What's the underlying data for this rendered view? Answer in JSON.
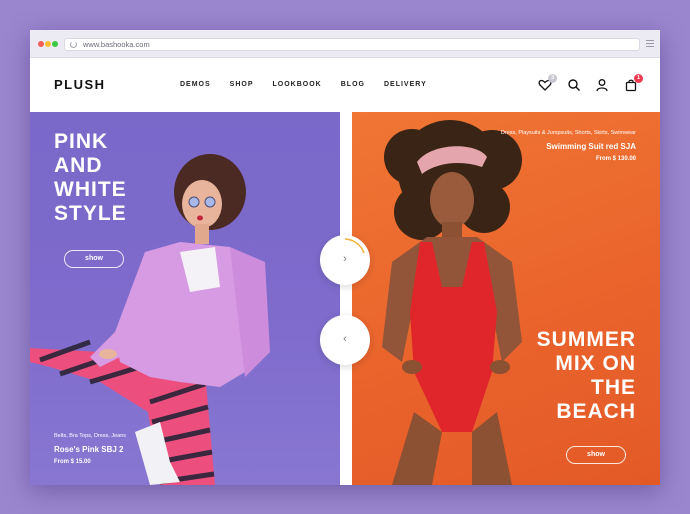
{
  "browser": {
    "url": "www.bashooka.com"
  },
  "header": {
    "logo": "PLUSH",
    "nav": [
      "DEMOS",
      "SHOP",
      "LOOKBOOK",
      "BLOG",
      "DELIVERY"
    ],
    "wishlist_count": "3",
    "cart_count": "1",
    "accent_color": "#ef3a52"
  },
  "left_slide": {
    "title_lines": [
      "PINK",
      "AND",
      "WHITE",
      "STYLE"
    ],
    "button_label": "show",
    "product_categories": "Belts, Bra Tops, Dress, Jeans",
    "product_name": "Rose's Pink SBJ 2",
    "product_price": "From $ 15.00",
    "background_color": "#7d6acb"
  },
  "right_slide": {
    "title_lines": [
      "SUMMER",
      "MIX ON",
      "THE",
      "BEACH"
    ],
    "button_label": "show",
    "product_categories": "Dress, Playsuits & Jumpsuits, Shorts, Skirts, Swimwear",
    "product_name": "Swimming Suit red SJA",
    "product_price": "From $ 130.00",
    "background_color": "#ec6a2f"
  },
  "slider": {
    "next_icon": "chevron-right-icon",
    "prev_icon": "chevron-left-icon",
    "next_glyph": "›",
    "prev_glyph": "‹"
  }
}
